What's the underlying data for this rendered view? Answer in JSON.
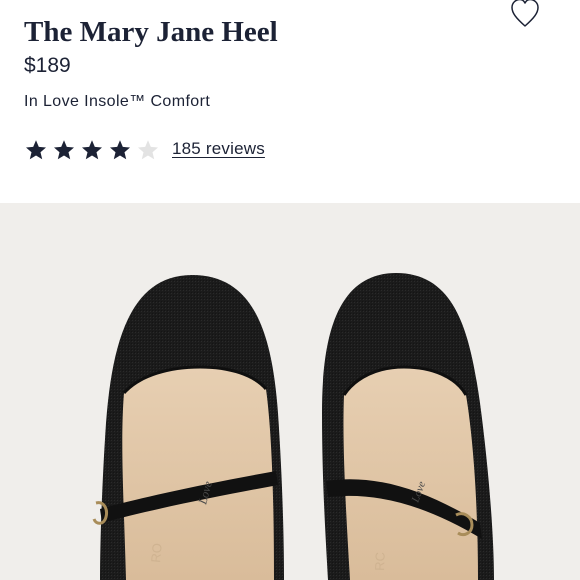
{
  "product": {
    "title": "The Mary Jane Heel",
    "price": "$189",
    "comfort_feature": "In Love Insole™ Comfort"
  },
  "rating": {
    "filled_stars": 4,
    "total_stars": 5,
    "reviews_label": "185 reviews"
  },
  "colors": {
    "text": "#1c2235",
    "star_filled": "#1c2235",
    "star_empty": "#e3e3e3",
    "image_background": "#f0eeeb"
  },
  "icons": {
    "wishlist": "heart-outline-icon",
    "star": "star-icon"
  },
  "image": {
    "alt": "Pair of black knit Mary Jane heels, top view",
    "insole_brand_mark": "Love"
  }
}
